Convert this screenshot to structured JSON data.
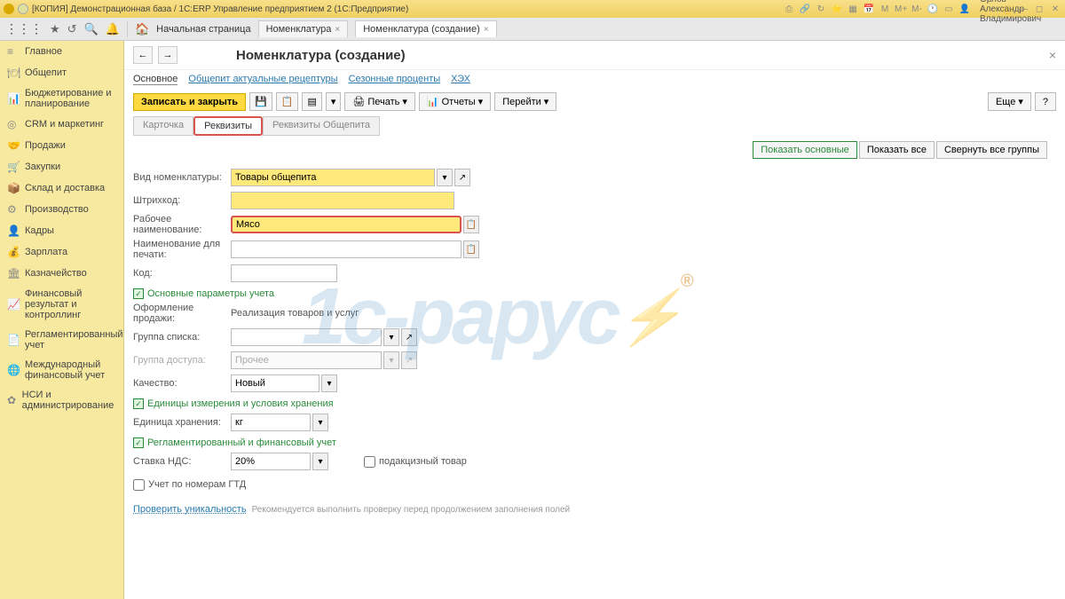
{
  "titlebar": {
    "title": "[КОПИЯ] Демонстрационная база / 1С:ERP Управление предприятием 2  (1С:Предприятие)",
    "user": "Орлов Александр Владимирович"
  },
  "toptabs": {
    "home": "Начальная страница",
    "tab1": "Номенклатура",
    "tab2": "Номенклатура (создание)"
  },
  "sidebar": {
    "items": [
      "Главное",
      "Общепит",
      "Бюджетирование и планирование",
      "CRM и маркетинг",
      "Продажи",
      "Закупки",
      "Склад и доставка",
      "Производство",
      "Кадры",
      "Зарплата",
      "Казначейство",
      "Финансовый результат и контроллинг",
      "Регламентированный учет",
      "Международный финансовый учет",
      "НСИ и администрирование"
    ]
  },
  "page": {
    "title": "Номенклатура (создание)",
    "subnav": {
      "main": "Основное",
      "link1": "Общепит актуальные рецептуры",
      "link2": "Сезонные проценты",
      "link3": "ХЭХ"
    },
    "actions": {
      "save": "Записать и закрыть",
      "print": "Печать",
      "reports": "Отчеты",
      "goto": "Перейти",
      "more": "Еще",
      "help": "?"
    },
    "formtabs": {
      "card": "Карточка",
      "props": "Реквизиты",
      "catering": "Реквизиты Общепита"
    },
    "rightbtns": {
      "main": "Показать основные",
      "all": "Показать все",
      "collapse": "Свернуть все группы"
    }
  },
  "form": {
    "type_label": "Вид номенклатуры:",
    "type_value": "Товары общепита",
    "barcode_label": "Штрихкод:",
    "barcode_value": "",
    "workname_label": "Рабочее наименование:",
    "workname_value": "Мясо",
    "printname_label": "Наименование для печати:",
    "printname_value": "",
    "code_label": "Код:",
    "code_value": "",
    "section1": "Основные параметры учета",
    "sale_label": "Оформление продажи:",
    "sale_value": "Реализация товаров и услуг",
    "group_label": "Группа списка:",
    "group_value": "",
    "access_label": "Группа доступа:",
    "access_value": "Прочее",
    "quality_label": "Качество:",
    "quality_value": "Новый",
    "section2": "Единицы измерения и условия хранения",
    "unit_label": "Единица хранения:",
    "unit_value": "кг",
    "section3": "Регламентированный и финансовый учет",
    "vat_label": "Ставка НДС:",
    "vat_value": "20%",
    "excise_label": "подакцизный товар",
    "gtd_label": "Учет по номерам ГТД",
    "check_link": "Проверить уникальность",
    "check_hint": "Рекомендуется выполнить проверку перед продолжением заполнения полей"
  },
  "watermark": "1с-рарус"
}
